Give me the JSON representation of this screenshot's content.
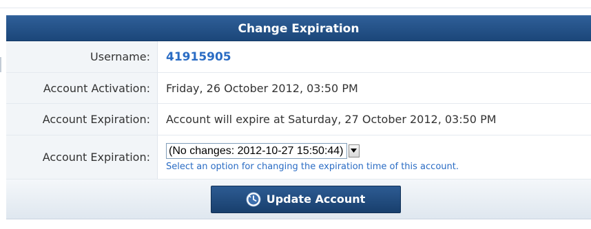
{
  "panel": {
    "title": "Change Expiration"
  },
  "rows": {
    "username": {
      "label": "Username:",
      "value": "41915905"
    },
    "activation": {
      "label": "Account Activation:",
      "value": "Friday, 26 October 2012, 03:50 PM"
    },
    "expiration_info": {
      "label": "Account Expiration:",
      "value": "Account will expire at Saturday, 27 October 2012, 03:50 PM"
    },
    "expiration_select": {
      "label": "Account Expiration:",
      "selected_option": "(No changes: 2012-10-27 15:50:44)",
      "hint": "Select an option for changing the expiration time of this account."
    }
  },
  "footer": {
    "update_button_label": "Update Account",
    "update_button_icon": "refresh-clock-icon"
  },
  "colors": {
    "header_bg": "#1b4679",
    "link_blue": "#2a6cc4",
    "label_bg": "#f2f5f8"
  }
}
